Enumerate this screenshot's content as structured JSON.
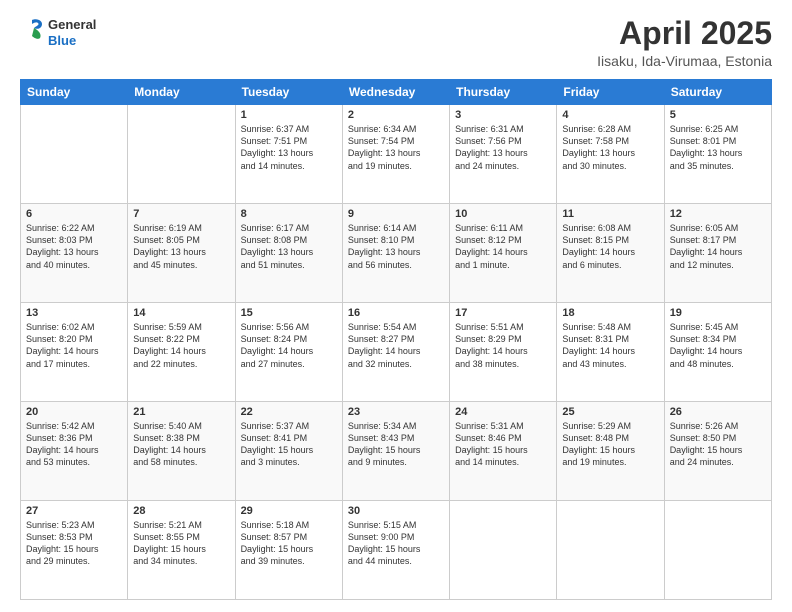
{
  "header": {
    "logo_line1": "General",
    "logo_line2": "Blue",
    "month": "April 2025",
    "location": "Iisaku, Ida-Virumaa, Estonia"
  },
  "weekdays": [
    "Sunday",
    "Monday",
    "Tuesday",
    "Wednesday",
    "Thursday",
    "Friday",
    "Saturday"
  ],
  "weeks": [
    [
      {
        "day": "",
        "info": ""
      },
      {
        "day": "",
        "info": ""
      },
      {
        "day": "1",
        "info": "Sunrise: 6:37 AM\nSunset: 7:51 PM\nDaylight: 13 hours\nand 14 minutes."
      },
      {
        "day": "2",
        "info": "Sunrise: 6:34 AM\nSunset: 7:54 PM\nDaylight: 13 hours\nand 19 minutes."
      },
      {
        "day": "3",
        "info": "Sunrise: 6:31 AM\nSunset: 7:56 PM\nDaylight: 13 hours\nand 24 minutes."
      },
      {
        "day": "4",
        "info": "Sunrise: 6:28 AM\nSunset: 7:58 PM\nDaylight: 13 hours\nand 30 minutes."
      },
      {
        "day": "5",
        "info": "Sunrise: 6:25 AM\nSunset: 8:01 PM\nDaylight: 13 hours\nand 35 minutes."
      }
    ],
    [
      {
        "day": "6",
        "info": "Sunrise: 6:22 AM\nSunset: 8:03 PM\nDaylight: 13 hours\nand 40 minutes."
      },
      {
        "day": "7",
        "info": "Sunrise: 6:19 AM\nSunset: 8:05 PM\nDaylight: 13 hours\nand 45 minutes."
      },
      {
        "day": "8",
        "info": "Sunrise: 6:17 AM\nSunset: 8:08 PM\nDaylight: 13 hours\nand 51 minutes."
      },
      {
        "day": "9",
        "info": "Sunrise: 6:14 AM\nSunset: 8:10 PM\nDaylight: 13 hours\nand 56 minutes."
      },
      {
        "day": "10",
        "info": "Sunrise: 6:11 AM\nSunset: 8:12 PM\nDaylight: 14 hours\nand 1 minute."
      },
      {
        "day": "11",
        "info": "Sunrise: 6:08 AM\nSunset: 8:15 PM\nDaylight: 14 hours\nand 6 minutes."
      },
      {
        "day": "12",
        "info": "Sunrise: 6:05 AM\nSunset: 8:17 PM\nDaylight: 14 hours\nand 12 minutes."
      }
    ],
    [
      {
        "day": "13",
        "info": "Sunrise: 6:02 AM\nSunset: 8:20 PM\nDaylight: 14 hours\nand 17 minutes."
      },
      {
        "day": "14",
        "info": "Sunrise: 5:59 AM\nSunset: 8:22 PM\nDaylight: 14 hours\nand 22 minutes."
      },
      {
        "day": "15",
        "info": "Sunrise: 5:56 AM\nSunset: 8:24 PM\nDaylight: 14 hours\nand 27 minutes."
      },
      {
        "day": "16",
        "info": "Sunrise: 5:54 AM\nSunset: 8:27 PM\nDaylight: 14 hours\nand 32 minutes."
      },
      {
        "day": "17",
        "info": "Sunrise: 5:51 AM\nSunset: 8:29 PM\nDaylight: 14 hours\nand 38 minutes."
      },
      {
        "day": "18",
        "info": "Sunrise: 5:48 AM\nSunset: 8:31 PM\nDaylight: 14 hours\nand 43 minutes."
      },
      {
        "day": "19",
        "info": "Sunrise: 5:45 AM\nSunset: 8:34 PM\nDaylight: 14 hours\nand 48 minutes."
      }
    ],
    [
      {
        "day": "20",
        "info": "Sunrise: 5:42 AM\nSunset: 8:36 PM\nDaylight: 14 hours\nand 53 minutes."
      },
      {
        "day": "21",
        "info": "Sunrise: 5:40 AM\nSunset: 8:38 PM\nDaylight: 14 hours\nand 58 minutes."
      },
      {
        "day": "22",
        "info": "Sunrise: 5:37 AM\nSunset: 8:41 PM\nDaylight: 15 hours\nand 3 minutes."
      },
      {
        "day": "23",
        "info": "Sunrise: 5:34 AM\nSunset: 8:43 PM\nDaylight: 15 hours\nand 9 minutes."
      },
      {
        "day": "24",
        "info": "Sunrise: 5:31 AM\nSunset: 8:46 PM\nDaylight: 15 hours\nand 14 minutes."
      },
      {
        "day": "25",
        "info": "Sunrise: 5:29 AM\nSunset: 8:48 PM\nDaylight: 15 hours\nand 19 minutes."
      },
      {
        "day": "26",
        "info": "Sunrise: 5:26 AM\nSunset: 8:50 PM\nDaylight: 15 hours\nand 24 minutes."
      }
    ],
    [
      {
        "day": "27",
        "info": "Sunrise: 5:23 AM\nSunset: 8:53 PM\nDaylight: 15 hours\nand 29 minutes."
      },
      {
        "day": "28",
        "info": "Sunrise: 5:21 AM\nSunset: 8:55 PM\nDaylight: 15 hours\nand 34 minutes."
      },
      {
        "day": "29",
        "info": "Sunrise: 5:18 AM\nSunset: 8:57 PM\nDaylight: 15 hours\nand 39 minutes."
      },
      {
        "day": "30",
        "info": "Sunrise: 5:15 AM\nSunset: 9:00 PM\nDaylight: 15 hours\nand 44 minutes."
      },
      {
        "day": "",
        "info": ""
      },
      {
        "day": "",
        "info": ""
      },
      {
        "day": "",
        "info": ""
      }
    ]
  ]
}
